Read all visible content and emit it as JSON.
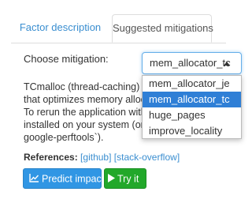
{
  "tabs": [
    {
      "label": "Factor description",
      "active": false
    },
    {
      "label": "Suggested mitigations",
      "active": true
    }
  ],
  "mitigation": {
    "label": "Choose mitigation:",
    "selected": "mem_allocator_tc",
    "options": [
      "mem_allocator_je",
      "mem_allocator_tc",
      "huge_pages",
      "improve_locality"
    ],
    "highlighted_index": 1
  },
  "description": {
    "lines": [
      "TCmalloc (thread-caching) is an",
      "that optimizes memory allocati",
      "To rerun the application with TC",
      "installed on your system (on ub",
      "google-perftools`)."
    ]
  },
  "references": {
    "label": "References:",
    "links": [
      {
        "text": "github",
        "open": "[",
        "close": "]"
      },
      {
        "text": "stack-overflow",
        "open": "[",
        "close": "]"
      }
    ]
  },
  "buttons": {
    "predict": "Predict impact",
    "try": "Try it"
  },
  "colors": {
    "link": "#3a8ed0",
    "predict_button": "#3096e4",
    "try_button": "#22a82a",
    "selected_option": "#2f7fd6"
  }
}
